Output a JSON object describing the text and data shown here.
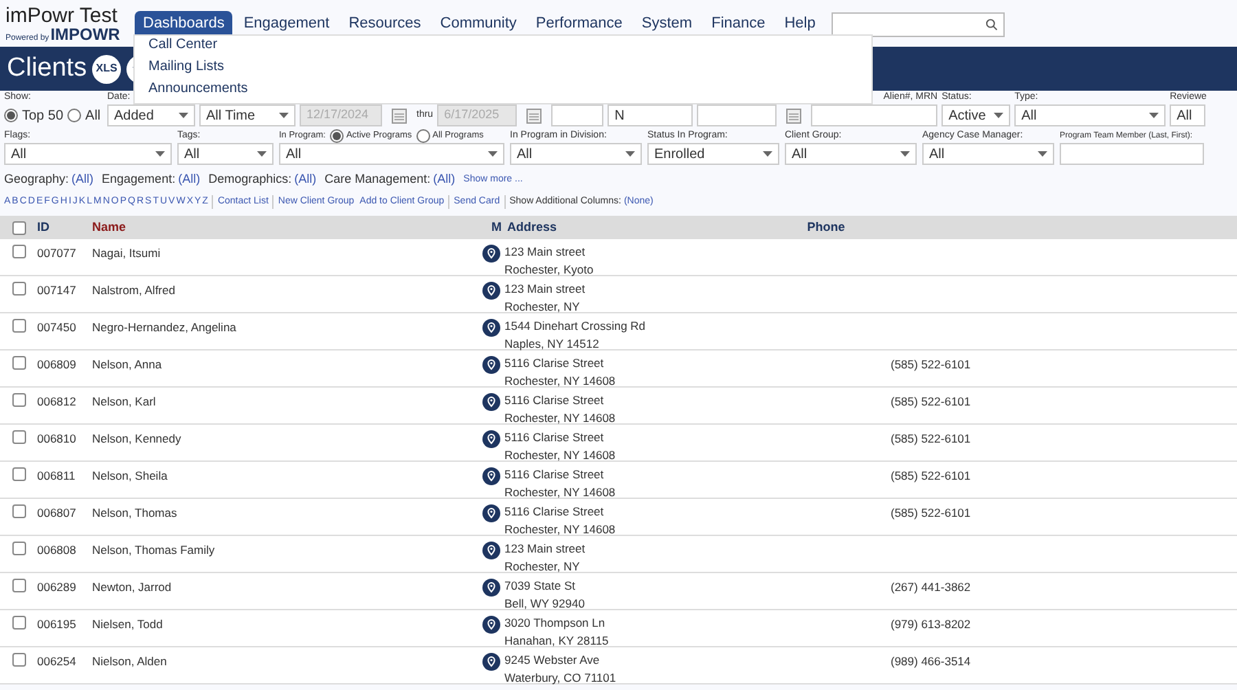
{
  "brand": {
    "title": "imPowr Test",
    "powered_by": "Powered by",
    "logo": "IMPOWR"
  },
  "nav": [
    {
      "label": "Dashboards",
      "selected": true
    },
    {
      "label": "Engagement",
      "selected": false
    },
    {
      "label": "Resources",
      "selected": false
    },
    {
      "label": "Community",
      "selected": false
    },
    {
      "label": "Performance",
      "selected": false
    },
    {
      "label": "System",
      "selected": false
    },
    {
      "label": "Finance",
      "selected": false
    },
    {
      "label": "Help",
      "selected": false
    }
  ],
  "dropdown": [
    "Call Center",
    "Mailing Lists",
    "Announcements"
  ],
  "page_title": "Clients",
  "xls_button": "XLS",
  "show": {
    "label": "Show:",
    "options": [
      {
        "label": "Top 50",
        "selected": true
      },
      {
        "label": "All",
        "selected": false
      }
    ]
  },
  "date": {
    "label": "Date:",
    "field": "Added",
    "range": "All Time",
    "from": "12/17/2024",
    "thru": "thru",
    "to": "6/17/2025"
  },
  "id_fields": {
    "middle": "N",
    "label": "Alien#, MRN"
  },
  "status": {
    "label": "Status:",
    "value": "Active"
  },
  "type": {
    "label": "Type:",
    "value": "All"
  },
  "reviewer": {
    "label": "Reviewe",
    "value": "All"
  },
  "filters": [
    {
      "label": "Flags:",
      "value": "All",
      "kind": "select"
    },
    {
      "label": "Tags:",
      "value": "All",
      "kind": "select"
    },
    {
      "label": "In Program:",
      "value": "All",
      "kind": "program"
    },
    {
      "label": "In Program in Division:",
      "value": "All",
      "kind": "select"
    },
    {
      "label": "Status In Program:",
      "value": "Enrolled",
      "kind": "select"
    },
    {
      "label": "Client Group:",
      "value": "All",
      "kind": "select"
    },
    {
      "label": "Agency Case Manager:",
      "value": "All",
      "kind": "select"
    },
    {
      "label": "Program Team Member (Last, First):",
      "kind": "text"
    }
  ],
  "program_options": [
    {
      "label": "Active Programs",
      "selected": true
    },
    {
      "label": "All Programs",
      "selected": false
    }
  ],
  "categories": [
    {
      "label": "Geography:",
      "value": "(All)"
    },
    {
      "label": "Engagement:",
      "value": "(All)"
    },
    {
      "label": "Demographics:",
      "value": "(All)"
    },
    {
      "label": "Care Management:",
      "value": "(All)"
    }
  ],
  "show_more": "Show more ...",
  "letters": [
    "A",
    "B",
    "C",
    "D",
    "E",
    "F",
    "G",
    "H",
    "I",
    "J",
    "K",
    "L",
    "M",
    "N",
    "O",
    "P",
    "Q",
    "R",
    "S",
    "T",
    "U",
    "V",
    "W",
    "X",
    "Y",
    "Z"
  ],
  "actions": [
    [
      "Contact List"
    ],
    [
      "New Client Group",
      "Add to Client Group"
    ],
    [
      "Send Card"
    ]
  ],
  "additional_columns": {
    "label": "Show Additional Columns:",
    "value": "(None)"
  },
  "table": {
    "all_checked": false,
    "columns": [
      "ID",
      "Name",
      "M",
      "Address",
      "Phone"
    ],
    "rows": [
      {
        "id": "007077",
        "name": "Nagai, Itsumi",
        "address": [
          "123 Main street",
          "Rochester, Kyoto"
        ],
        "phone": "",
        "checked": false
      },
      {
        "id": "007147",
        "name": "Nalstrom, Alfred",
        "address": [
          "123 Main street",
          "Rochester, NY"
        ],
        "phone": "",
        "checked": false
      },
      {
        "id": "007450",
        "name": "Negro-Hernandez, Angelina",
        "address": [
          "1544 Dinehart Crossing Rd",
          "Naples, NY 14512"
        ],
        "phone": "",
        "checked": false
      },
      {
        "id": "006809",
        "name": "Nelson, Anna",
        "address": [
          "5116 Clarise Street",
          "Rochester, NY 14608"
        ],
        "phone": "(585) 522-6101",
        "checked": false
      },
      {
        "id": "006812",
        "name": "Nelson, Karl",
        "address": [
          "5116 Clarise Street",
          "Rochester, NY 14608"
        ],
        "phone": "(585) 522-6101",
        "checked": false
      },
      {
        "id": "006810",
        "name": "Nelson, Kennedy",
        "address": [
          "5116 Clarise Street",
          "Rochester, NY 14608"
        ],
        "phone": "(585) 522-6101",
        "checked": false
      },
      {
        "id": "006811",
        "name": "Nelson, Sheila",
        "address": [
          "5116 Clarise Street",
          "Rochester, NY 14608"
        ],
        "phone": "(585) 522-6101",
        "checked": false
      },
      {
        "id": "006807",
        "name": "Nelson, Thomas",
        "address": [
          "5116 Clarise Street",
          "Rochester, NY 14608"
        ],
        "phone": "(585) 522-6101",
        "checked": false
      },
      {
        "id": "006808",
        "name": "Nelson, Thomas Family",
        "address": [
          "123 Main street",
          "Rochester, NY"
        ],
        "phone": "",
        "checked": false
      },
      {
        "id": "006289",
        "name": "Newton, Jarrod",
        "address": [
          "7039 State St",
          "Bell, WY 92940"
        ],
        "phone": "(267) 441-3862",
        "checked": false
      },
      {
        "id": "006195",
        "name": "Nielsen, Todd",
        "address": [
          "3020 Thompson Ln",
          "Hanahan, KY 28115"
        ],
        "phone": "(979) 613-8202",
        "checked": false
      },
      {
        "id": "006254",
        "name": "Nielson, Alden",
        "address": [
          "9245 Webster Ave",
          "Waterbury, CO 71101"
        ],
        "phone": "(989) 466-3514",
        "checked": false
      }
    ]
  }
}
